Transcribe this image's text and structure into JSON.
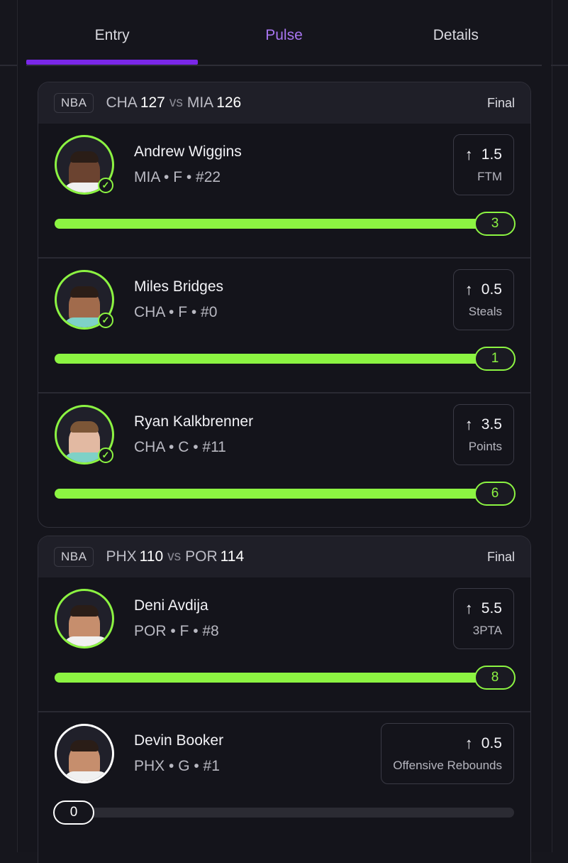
{
  "tabs": [
    {
      "label": "Entry",
      "active": true
    },
    {
      "label": "Pulse"
    },
    {
      "label": "Details"
    }
  ],
  "colors": {
    "accent": "#7a27e8",
    "hit": "#8cf442",
    "pulse_text": "#a875f0"
  },
  "games": [
    {
      "league": "NBA",
      "home": {
        "team": "CHA",
        "score": "127"
      },
      "vs": "vs",
      "away": {
        "team": "MIA",
        "score": "126"
      },
      "status": "Final",
      "players": [
        {
          "name": "Andrew Wiggins",
          "info": "MIA • F • #22",
          "line": "1.5",
          "stat": "FTM",
          "result": "3",
          "progress": 1.0,
          "hit": true
        },
        {
          "name": "Miles Bridges",
          "info": "CHA • F • #0",
          "line": "0.5",
          "stat": "Steals",
          "result": "1",
          "progress": 1.0,
          "hit": true
        },
        {
          "name": "Ryan Kalkbrenner",
          "info": "CHA • C • #11",
          "line": "3.5",
          "stat": "Points",
          "result": "6",
          "progress": 1.0,
          "hit": true
        }
      ]
    },
    {
      "league": "NBA",
      "home": {
        "team": "PHX",
        "score": "110"
      },
      "vs": "vs",
      "away": {
        "team": "POR",
        "score": "114"
      },
      "status": "Final",
      "players": [
        {
          "name": "Deni Avdija",
          "info": "POR • F • #8",
          "line": "5.5",
          "stat": "3PTA",
          "result": "8",
          "progress": 1.0,
          "hit": true
        },
        {
          "name": "Devin Booker",
          "info": "PHX • G • #1",
          "line": "0.5",
          "stat": "Offensive Rebounds",
          "result": "0",
          "progress": 0.0,
          "hit": false
        }
      ]
    }
  ],
  "icons": {
    "arrow": "arrow-up-icon",
    "check": "check-circle-icon"
  }
}
